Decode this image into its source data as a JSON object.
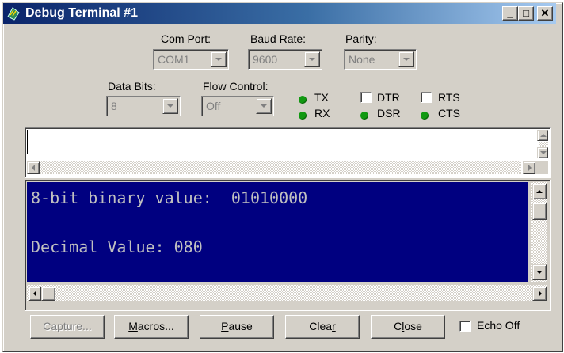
{
  "window": {
    "title": "Debug Terminal #1"
  },
  "title_buttons": {
    "minimize": "_",
    "maximize": "□",
    "close": "✕"
  },
  "settings": {
    "com_port": {
      "label": "Com Port:",
      "value": "COM1"
    },
    "baud_rate": {
      "label": "Baud Rate:",
      "value": "9600"
    },
    "parity": {
      "label": "Parity:",
      "value": "None"
    },
    "data_bits": {
      "label": "Data Bits:",
      "value": "8"
    },
    "flow_control": {
      "label": "Flow Control:",
      "value": "Off"
    }
  },
  "signals": {
    "tx": "TX",
    "rx": "RX",
    "dtr": "DTR",
    "rts": "RTS",
    "dsr": "DSR",
    "cts": "CTS",
    "led_color": "#119911"
  },
  "transmit": {
    "text": ""
  },
  "terminal": {
    "lines": [
      "8-bit binary value:  01010000",
      "",
      "Decimal Value: 080"
    ],
    "background": "#000080",
    "text_color": "#c0c0c0"
  },
  "buttons": {
    "capture": "Capture...",
    "macros_m": "M",
    "macros_rest": "acros...",
    "pause_p": "P",
    "pause_rest": "ause",
    "clear_pre": "Clea",
    "clear_r": "r",
    "close_pre": "C",
    "close_l": "l",
    "close_rest": "ose",
    "echo_off": "Echo Off"
  }
}
